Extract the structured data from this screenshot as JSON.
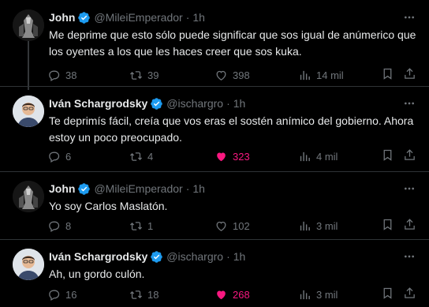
{
  "tweets": [
    {
      "name": "John",
      "handle": "@MileiEmperador",
      "time": "1h",
      "text": "Me deprime que esto sólo puede significar que sos igual de anúmerico que los oyentes a los que les haces creer que sos kuka.",
      "replies": "38",
      "retweets": "39",
      "likes": "398",
      "views": "14 mil",
      "liked": false
    },
    {
      "name": "Iván Schargrodsky",
      "handle": "@ischargro",
      "time": "1h",
      "text": "Te deprimís fácil, creía que vos eras el sostén anímico del gobierno. Ahora estoy un poco preocupado.",
      "replies": "6",
      "retweets": "4",
      "likes": "323",
      "views": "4 mil",
      "liked": true
    },
    {
      "name": "John",
      "handle": "@MileiEmperador",
      "time": "1h",
      "text": "Yo soy Carlos Maslatón.",
      "replies": "8",
      "retweets": "1",
      "likes": "102",
      "views": "3 mil",
      "liked": false
    },
    {
      "name": "Iván Schargrodsky",
      "handle": "@ischargro",
      "time": "1h",
      "text": "Ah, un gordo culón.",
      "replies": "16",
      "retweets": "18",
      "likes": "268",
      "views": "3 mil",
      "liked": true
    }
  ],
  "colors": {
    "background": "#000000",
    "text": "#e7e9ea",
    "muted": "#71767b",
    "verified": "#1d9bf0",
    "like": "#f91880",
    "border": "#2f3336"
  }
}
